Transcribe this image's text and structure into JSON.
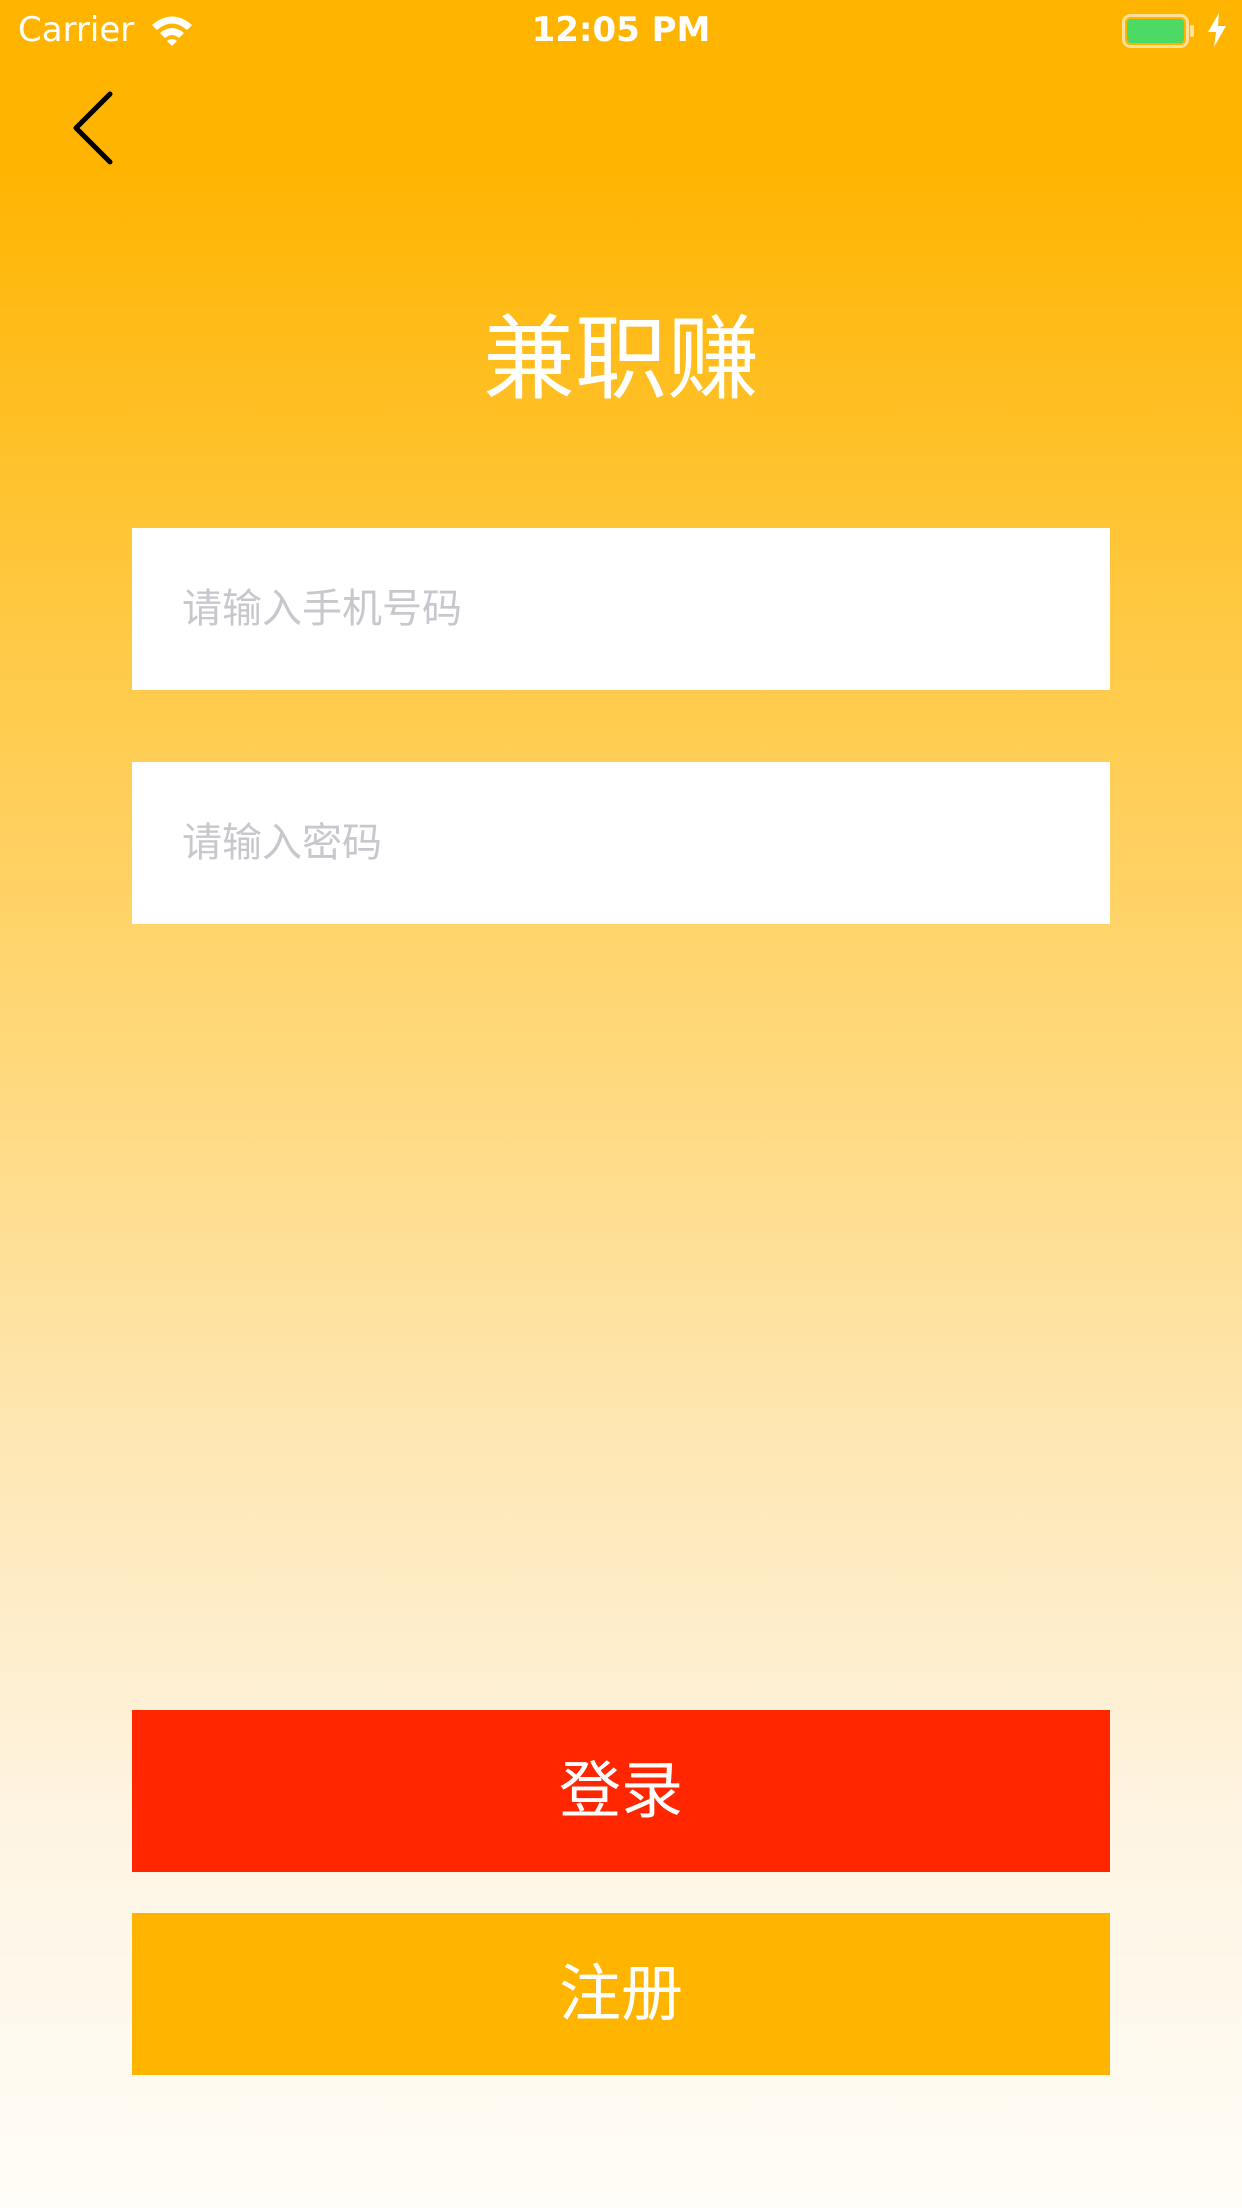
{
  "status_bar": {
    "carrier": "Carrier",
    "time": "12:05 PM",
    "wifi_icon": "wifi-icon",
    "battery_icon": "battery-icon",
    "charging_icon": "charging-bolt-icon",
    "battery_color": "#4cd964"
  },
  "nav": {
    "back_icon": "chevron-left-icon"
  },
  "app": {
    "title": "兼职赚"
  },
  "form": {
    "phone_placeholder": "请输入手机号码",
    "phone_value": "",
    "password_placeholder": "请输入密码",
    "password_value": ""
  },
  "actions": {
    "login_label": "登录",
    "register_label": "注册"
  },
  "colors": {
    "background_top": "#ffb400",
    "background_bottom": "#fffdf7",
    "login_button": "#ff2600",
    "register_button": "#ffb400",
    "field_background": "#ffffff",
    "placeholder_text": "#c7c7cd"
  }
}
